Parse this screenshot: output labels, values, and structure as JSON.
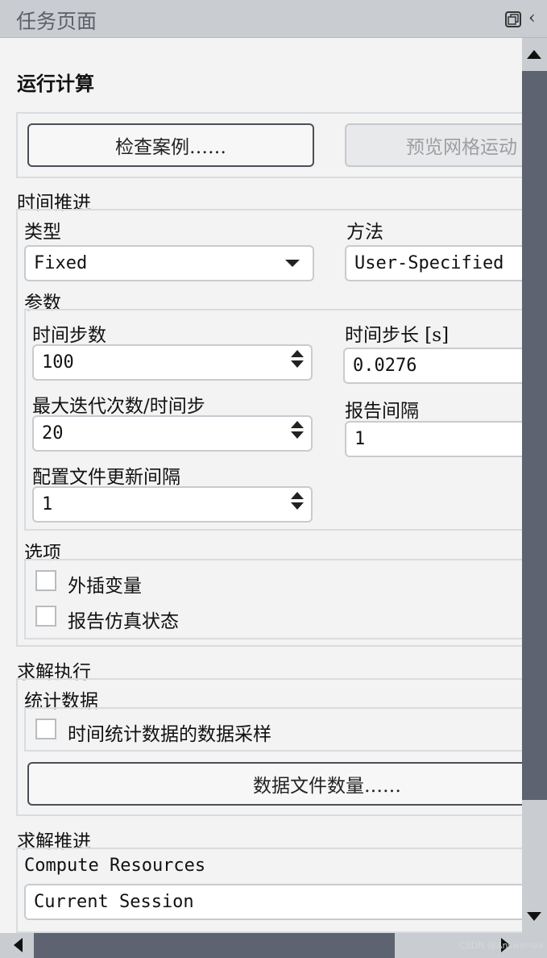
{
  "titlebar": {
    "title": "任务页面"
  },
  "header": {
    "title": "运行计算"
  },
  "actions": {
    "check_case": "检查案例……",
    "preview_mesh": "预览网格运动"
  },
  "time_advance": {
    "section": "时间推进",
    "type_label": "类型",
    "type_value": "Fixed",
    "method_label": "方法",
    "method_value": "User-Specified",
    "params_label": "参数",
    "steps_label": "时间步数",
    "steps_value": "100",
    "step_size_label": "时间步长 [s]",
    "step_size_value": "0.0276",
    "max_iter_label": "最大迭代次数/时间步",
    "max_iter_value": "20",
    "report_interval_label": "报告间隔",
    "report_interval_value": "1",
    "profile_update_label": "配置文件更新间隔",
    "profile_update_value": "1",
    "options_label": "选项",
    "opt_extrapolate": "外插变量",
    "opt_report_status": "报告仿真状态"
  },
  "solver_exec": {
    "section": "求解执行",
    "stats_label": "统计数据",
    "opt_sampling": "时间统计数据的数据采样",
    "data_file_button": "数据文件数量……"
  },
  "solver_advance": {
    "section": "求解推进",
    "compute_label": "Compute Resources",
    "compute_value": "Current Session"
  },
  "watermark": "CSDN @Answer-six",
  "colors": {
    "scroll_thumb": "#5d6370",
    "titlebar": "#c9cdd2",
    "accent_border": "#4a4f57"
  },
  "icons": [
    "restore-icon",
    "collapse-left-icon",
    "scroll-up-icon",
    "scroll-down-icon",
    "scroll-left-icon",
    "scroll-right-icon"
  ]
}
